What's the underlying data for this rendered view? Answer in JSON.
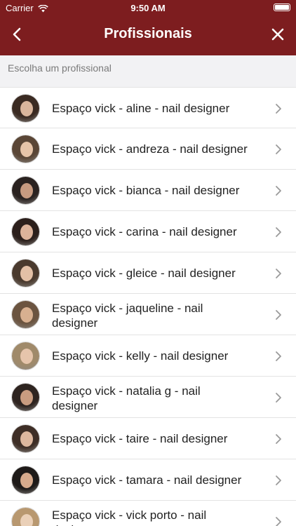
{
  "status_bar": {
    "carrier": "Carrier",
    "time": "9:50 AM"
  },
  "nav": {
    "title": "Profissionais"
  },
  "section_label": "Escolha um profissional",
  "professionals": [
    {
      "name": "Espaço vick - aline - nail designer"
    },
    {
      "name": "Espaço vick - andreza - nail designer"
    },
    {
      "name": "Espaço vick - bianca  - nail designer"
    },
    {
      "name": "Espaço vick - carina - nail designer"
    },
    {
      "name": "Espaço vick - gleice - nail designer"
    },
    {
      "name": "Espaço vick - jaqueline - nail designer"
    },
    {
      "name": "Espaço vick - kelly - nail designer"
    },
    {
      "name": "Espaço vick - natalia g - nail designer"
    },
    {
      "name": "Espaço vick - taire - nail designer"
    },
    {
      "name": "Espaço vick - tamara - nail designer"
    },
    {
      "name": "Espaço vick - vick porto - nail designer"
    }
  ],
  "colors": {
    "header": "#7d1d1f",
    "background": "#f2f2f4"
  }
}
